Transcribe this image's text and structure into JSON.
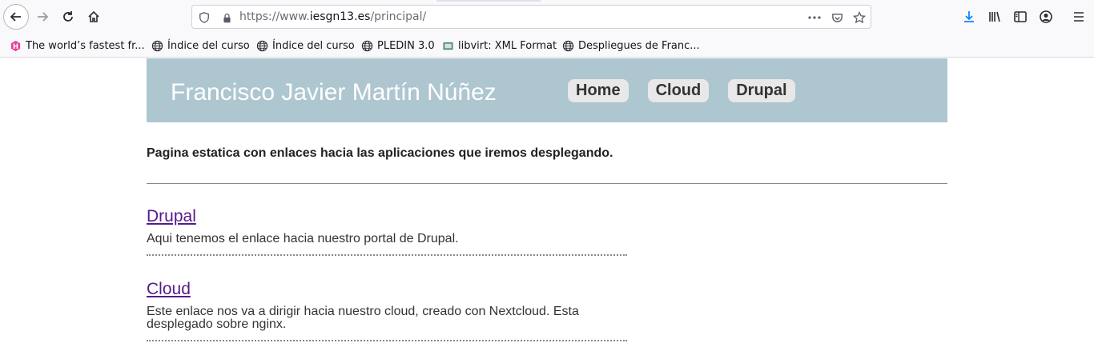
{
  "browser": {
    "url_prefix": "https://www.",
    "url_host": "iesgn13.es",
    "url_path": "/principal/",
    "bookmarks": [
      {
        "label": "The world’s fastest fr...",
        "icon": "hexagon-h-icon"
      },
      {
        "label": "Índice del curso",
        "icon": "globe-icon"
      },
      {
        "label": "Índice del curso",
        "icon": "globe-icon"
      },
      {
        "label": "PLEDIN 3.0",
        "icon": "globe-icon"
      },
      {
        "label": "libvirt: XML Format",
        "icon": "libvirt-icon"
      },
      {
        "label": "Despliegues de Franc...",
        "icon": "globe-icon"
      }
    ]
  },
  "site": {
    "title": "Francisco Javier Martín Núñez",
    "nav": [
      "Home",
      "Cloud",
      "Drupal"
    ],
    "intro": "Pagina estatica con enlaces hacia las aplicaciones que iremos desplegando.",
    "entries": [
      {
        "title": "Drupal",
        "text": "Aqui tenemos el enlace hacia nuestro portal de Drupal."
      },
      {
        "title": "Cloud",
        "text": "Este enlace nos va a dirigir hacia nuestro cloud, creado con Nextcloud. Esta desplegado sobre nginx."
      }
    ]
  },
  "colors": {
    "header_bg": "#aec6cf",
    "link_visited": "#551a8b"
  }
}
